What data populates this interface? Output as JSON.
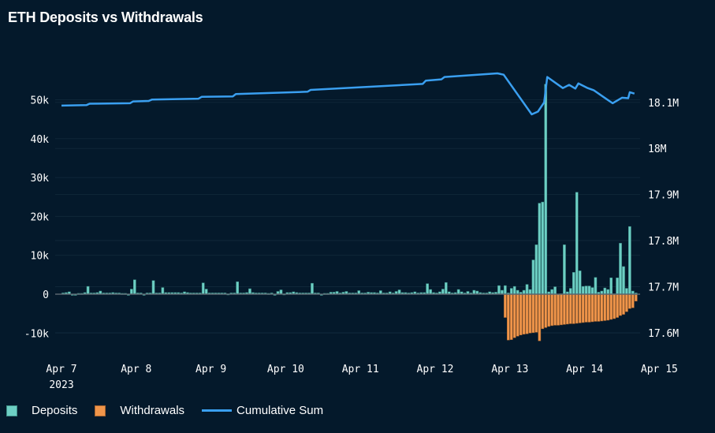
{
  "chart_data": {
    "type": "bar",
    "title": "ETH Deposits vs Withdrawals",
    "x_unit": "hours since Apr 7 2023 00:00",
    "x_ticks": [
      {
        "hour": 0,
        "label": "Apr 7",
        "sub": "2023"
      },
      {
        "hour": 24,
        "label": "Apr 8"
      },
      {
        "hour": 48,
        "label": "Apr 9"
      },
      {
        "hour": 72,
        "label": "Apr 10"
      },
      {
        "hour": 96,
        "label": "Apr 11"
      },
      {
        "hour": 120,
        "label": "Apr 12"
      },
      {
        "hour": 144,
        "label": "Apr 13"
      },
      {
        "hour": 168,
        "label": "Apr 14"
      },
      {
        "hour": 192,
        "label": "Apr 15"
      }
    ],
    "left_axis": {
      "unit": "k ETH",
      "ylim": [
        -13.6,
        64.5
      ],
      "ticks": [
        {
          "v": -10,
          "label": "-10k"
        },
        {
          "v": 0,
          "label": "0"
        },
        {
          "v": 10,
          "label": "10k"
        },
        {
          "v": 20,
          "label": "20k"
        },
        {
          "v": 30,
          "label": "30k"
        },
        {
          "v": 40,
          "label": "40k"
        },
        {
          "v": 50,
          "label": "50k"
        }
      ]
    },
    "right_axis": {
      "unit": "M ETH",
      "ylim": [
        17.569,
        18.228
      ],
      "ticks": [
        {
          "v": 17.6,
          "label": "17.6M"
        },
        {
          "v": 17.7,
          "label": "17.7M"
        },
        {
          "v": 17.8,
          "label": "17.8M"
        },
        {
          "v": 17.9,
          "label": "17.9M"
        },
        {
          "v": 18.0,
          "label": "18M"
        },
        {
          "v": 18.1,
          "label": "18.1M"
        }
      ]
    },
    "series": [
      {
        "name": "Deposits",
        "type": "bar",
        "axis": "left",
        "color": "#6dcfc4",
        "start_hour": 0,
        "values": [
          0.3,
          0.4,
          0.6,
          0,
          0,
          0.2,
          0.2,
          0.4,
          2.0,
          0.3,
          0.3,
          0.4,
          0.8,
          0.3,
          0.3,
          0.3,
          0.4,
          0.3,
          0.3,
          0.2,
          0.2,
          0,
          1.3,
          3.7,
          0.3,
          0.3,
          0,
          0.3,
          0.3,
          3.5,
          0.3,
          0.3,
          1.7,
          0.4,
          0.4,
          0.4,
          0.4,
          0.4,
          0.3,
          0.6,
          0.4,
          0.3,
          0.3,
          0.3,
          0.3,
          2.9,
          1.3,
          0.3,
          0.3,
          0.3,
          0.3,
          0.3,
          0.3,
          0.1,
          0.3,
          0.3,
          3.2,
          0.3,
          0.3,
          0.4,
          1.4,
          0.4,
          0.3,
          0.3,
          0.3,
          0.3,
          0.2,
          0.3,
          0,
          0.7,
          1.1,
          0.1,
          0.4,
          0.4,
          0.6,
          0.4,
          0.3,
          0.3,
          0.3,
          0.3,
          2.8,
          0.3,
          0.3,
          0,
          0.2,
          0.2,
          0.5,
          0.5,
          0.7,
          0.3,
          0.5,
          0.7,
          0.3,
          0.3,
          0.3,
          0.9,
          0.3,
          0.3,
          0.5,
          0.4,
          0.4,
          0.3,
          0.9,
          0.3,
          0.3,
          0.6,
          0.3,
          0.7,
          1.1,
          0.4,
          0.4,
          0.3,
          0.4,
          0.6,
          0.3,
          0.4,
          0.4,
          2.7,
          1.2,
          0.4,
          0.3,
          0.6,
          1.3,
          3.0,
          0.6,
          0.3,
          0.4,
          1.2,
          0.6,
          0.3,
          0.7,
          0.3,
          1.0,
          0.8,
          0.4,
          0.3,
          0.3,
          0.6,
          0.4,
          0.5,
          2.2,
          1,
          2.2,
          0.3,
          1.5,
          2,
          1,
          0.5,
          1,
          2.5,
          1.2,
          8.8,
          12.7,
          23.4,
          23.7,
          54,
          0.6,
          1.2,
          1.9,
          0,
          0.1,
          12.7,
          0.6,
          1.5,
          5.6,
          26.2,
          6.0,
          2,
          2.1,
          2.1,
          1.7,
          4.3,
          0.5,
          0.8,
          1.6,
          1.2,
          4.2,
          0.1,
          4.2,
          13.1,
          7.1,
          1.5,
          17.4,
          0.8,
          0.3
        ]
      },
      {
        "name": "Withdrawals",
        "type": "bar",
        "axis": "left",
        "color": "#f0954a",
        "start_hour": 142,
        "values": [
          -6,
          -11.8,
          -11.7,
          -11.2,
          -10.8,
          -10.5,
          -10.3,
          -10.2,
          -10,
          -9.9,
          -9.8,
          -12,
          -8.9,
          -8.6,
          -8.3,
          -8.1,
          -8,
          -8,
          -7.9,
          -7.8,
          -7.7,
          -7.6,
          -7.6,
          -7.5,
          -7.4,
          -7.3,
          -7.2,
          -7.2,
          -7.1,
          -7,
          -7,
          -6.9,
          -6.8,
          -6.7,
          -6.5,
          -6.3,
          -6,
          -5.5,
          -5.2,
          -4.5,
          -3.7,
          -3.5,
          -1.8
        ]
      },
      {
        "name": "Cumulative Sum",
        "type": "line",
        "axis": "right",
        "color": "#3a9ff0",
        "points": [
          [
            0,
            18.093
          ],
          [
            8,
            18.094
          ],
          [
            9,
            18.097
          ],
          [
            22,
            18.098
          ],
          [
            23,
            18.102
          ],
          [
            28,
            18.103
          ],
          [
            29,
            18.106
          ],
          [
            44,
            18.108
          ],
          [
            45,
            18.112
          ],
          [
            55,
            18.113
          ],
          [
            56,
            18.118
          ],
          [
            79,
            18.123
          ],
          [
            80,
            18.127
          ],
          [
            116,
            18.14
          ],
          [
            117,
            18.147
          ],
          [
            122,
            18.15
          ],
          [
            123,
            18.155
          ],
          [
            140,
            18.163
          ],
          [
            142,
            18.16
          ],
          [
            151,
            18.074
          ],
          [
            153,
            18.08
          ],
          [
            155,
            18.1
          ],
          [
            156,
            18.155
          ],
          [
            161,
            18.131
          ],
          [
            163,
            18.138
          ],
          [
            165,
            18.13
          ],
          [
            166,
            18.141
          ],
          [
            169,
            18.131
          ],
          [
            171,
            18.126
          ],
          [
            174,
            18.112
          ],
          [
            177,
            18.098
          ],
          [
            180,
            18.11
          ],
          [
            182,
            18.109
          ],
          [
            182.5,
            18.122
          ],
          [
            184,
            18.119
          ]
        ]
      }
    ],
    "legend": {
      "placement": "bottom-left",
      "items": [
        "Deposits",
        "Withdrawals",
        "Cumulative Sum"
      ]
    },
    "grid": true
  }
}
